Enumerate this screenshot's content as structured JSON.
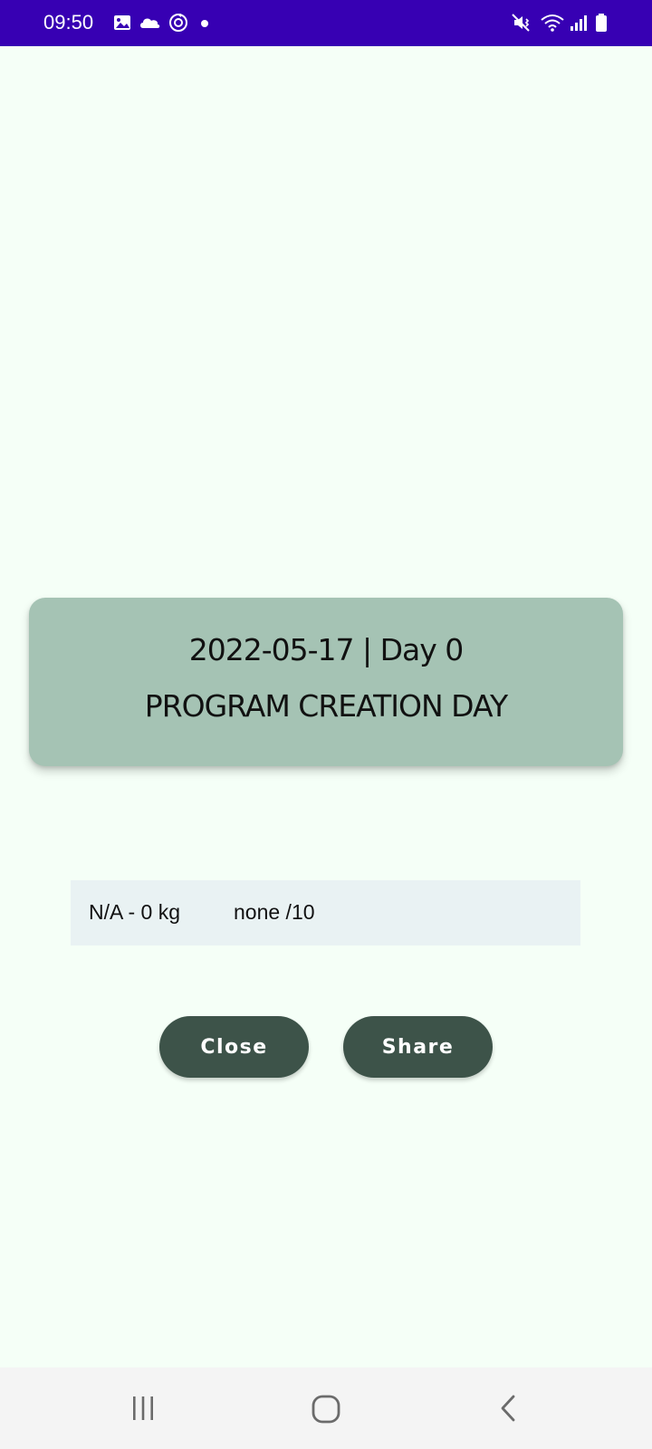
{
  "status_bar": {
    "time": "09:50",
    "background": "#3700b3",
    "left_icons": [
      "gallery-icon",
      "cloud-icon",
      "sync-icon",
      "dot-icon"
    ],
    "right_icons": [
      "vibrate-mute-icon",
      "wifi-icon",
      "signal-icon",
      "battery-icon"
    ]
  },
  "card": {
    "date_line": "2022-05-17 | Day 0",
    "title": "PROGRAM CREATION DAY",
    "background": "#a5c3b4"
  },
  "result": {
    "weight": "N/A - 0 kg",
    "score": "none /10",
    "background": "#e9f2f3"
  },
  "buttons": {
    "close_label": "Close",
    "share_label": "Share",
    "background": "#3d5349"
  },
  "nav_bar": {
    "icons": [
      "recents-icon",
      "home-icon",
      "back-icon"
    ]
  },
  "page_background": "#f5fff7"
}
